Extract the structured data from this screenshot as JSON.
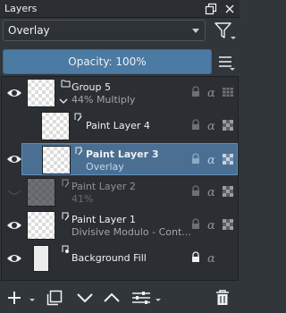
{
  "panel": {
    "title": "Layers"
  },
  "blend_mode": {
    "value": "Overlay"
  },
  "opacity": {
    "label": "Opacity:  100%"
  },
  "layers": [
    {
      "name": "Group 5",
      "sub": "44% Multiply"
    },
    {
      "name": "Paint Layer 4",
      "sub": ""
    },
    {
      "name": "Paint Layer 3",
      "sub": "Overlay"
    },
    {
      "name": "Paint Layer 2",
      "sub": "41%"
    },
    {
      "name": "Paint Layer 1",
      "sub": "Divisive Modulo - Cont..."
    },
    {
      "name": "Background Fill",
      "sub": ""
    }
  ],
  "colors": {
    "accent": "#4b7aa3",
    "selection": "#4a6f93",
    "background": "#31363b"
  },
  "icons": [
    "eye-icon",
    "lock-icon",
    "alpha-icon",
    "inherit-alpha-icon",
    "add-icon",
    "duplicate-icon",
    "move-down-icon",
    "move-up-icon",
    "properties-icon",
    "delete-icon",
    "filter-icon",
    "menu-icon"
  ]
}
